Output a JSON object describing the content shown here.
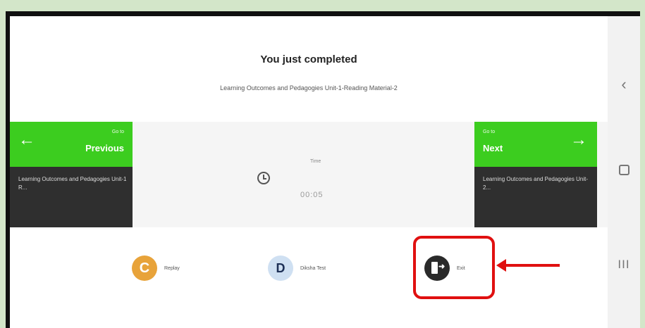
{
  "header": {
    "title": "You just completed",
    "subtitle": "Learning Outcomes and Pedagogies Unit-1-Reading Material-2"
  },
  "previous": {
    "go_to": "Go to",
    "label": "Previous",
    "arrow": "←",
    "item": "Learning Outcomes and Pedagogies Unit-1 R..."
  },
  "next": {
    "go_to": "Go to",
    "label": "Next",
    "arrow": "→",
    "item": "Learning Outcomes and Pedagogies Unit-2..."
  },
  "timer": {
    "label": "Time",
    "value": "00:05"
  },
  "actions": {
    "replay": {
      "icon_glyph": "C",
      "label": "Replay"
    },
    "d": {
      "icon_glyph": "D",
      "label": "Diksha Test"
    },
    "exit": {
      "icon_glyph": "➜",
      "label": "Exit"
    }
  },
  "system_nav": {
    "back": "‹",
    "recent": "III"
  },
  "colors": {
    "green": "#3ccd1f",
    "dark_card": "#2f2f2f",
    "replay_orange": "#e8a33a",
    "d_blue": "#cfe0f2",
    "exit_dark": "#2a2a2a",
    "highlight_red": "#e01010"
  }
}
